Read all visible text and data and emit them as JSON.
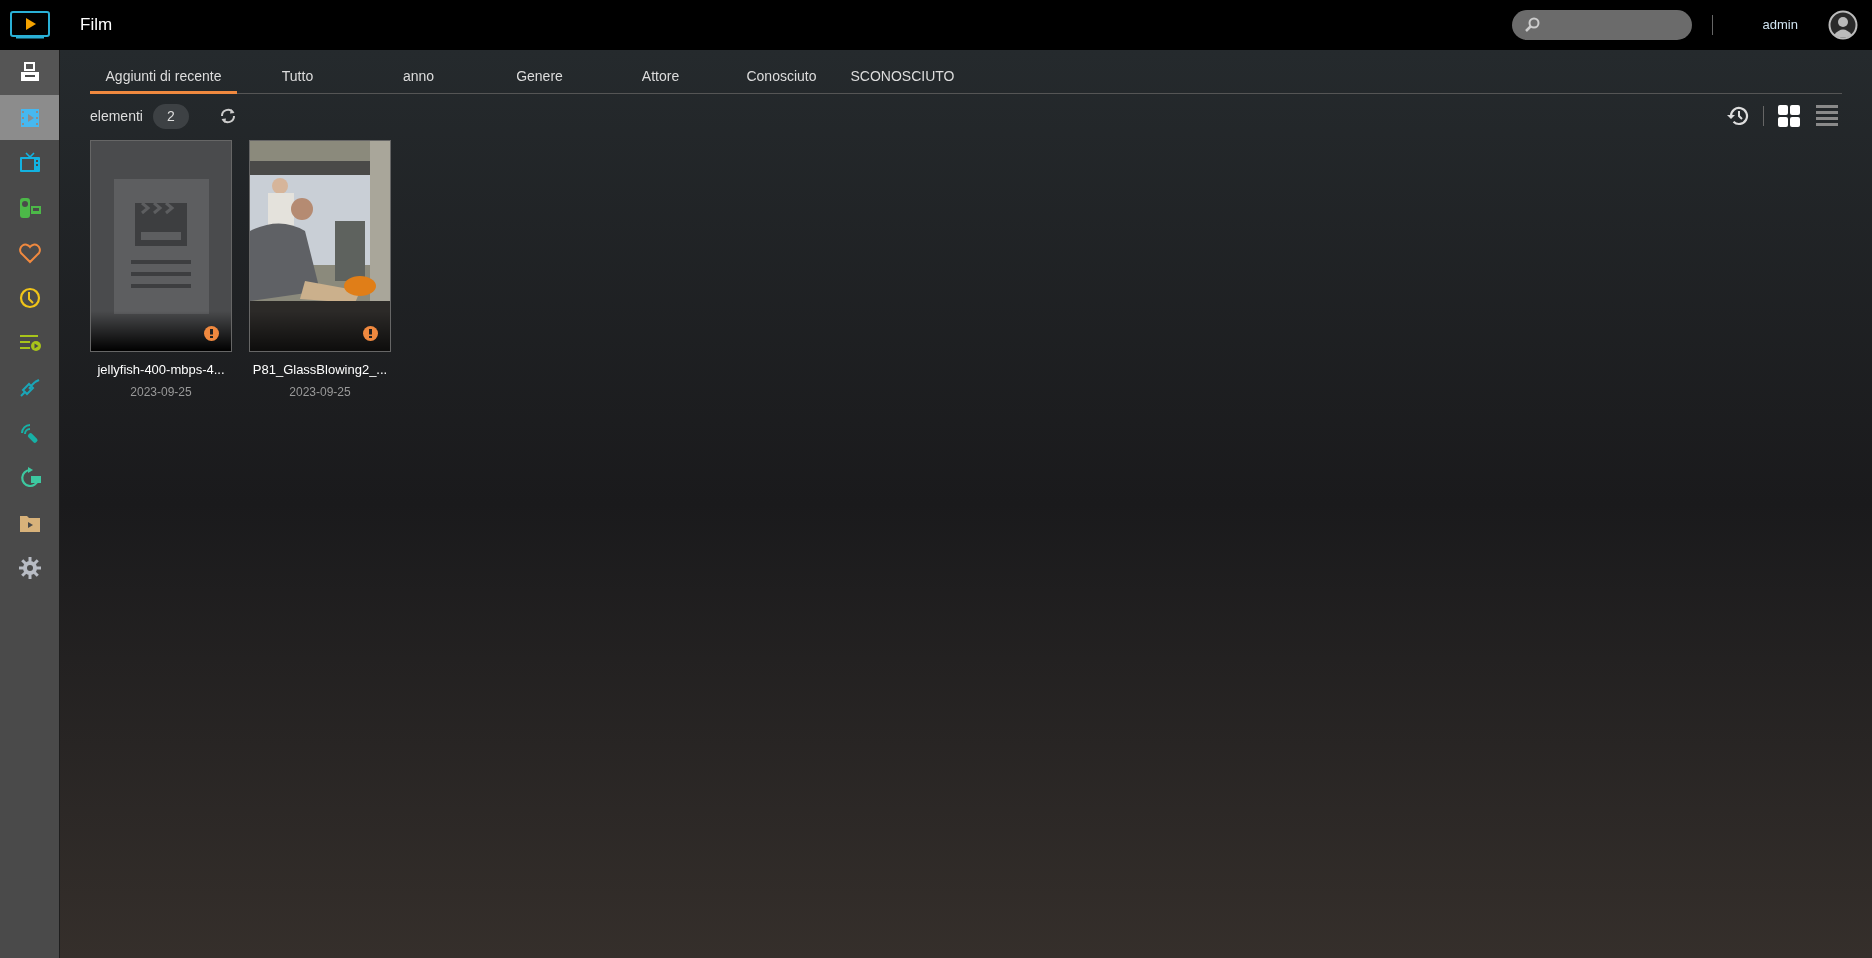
{
  "header": {
    "title": "Film",
    "user": "admin"
  },
  "sidebar": {
    "items": [
      {
        "kind": "server",
        "selected": false
      },
      {
        "kind": "film",
        "selected": true
      },
      {
        "kind": "tv",
        "selected": false
      },
      {
        "kind": "camera",
        "selected": false
      },
      {
        "kind": "heart",
        "selected": false
      },
      {
        "kind": "clock",
        "selected": false
      },
      {
        "kind": "playlist",
        "selected": false
      },
      {
        "kind": "link",
        "selected": false
      },
      {
        "kind": "remote",
        "selected": false
      },
      {
        "kind": "replay",
        "selected": false
      },
      {
        "kind": "folder",
        "selected": false
      },
      {
        "kind": "gear",
        "selected": false
      }
    ]
  },
  "tabs": [
    {
      "label": "Aggiunti di recente",
      "selected": true
    },
    {
      "label": "Tutto",
      "selected": false
    },
    {
      "label": "anno",
      "selected": false
    },
    {
      "label": "Genere",
      "selected": false
    },
    {
      "label": "Attore",
      "selected": false
    },
    {
      "label": "Conosciuto",
      "selected": false
    },
    {
      "label": "SCONOSCIUTO",
      "selected": false
    }
  ],
  "toolbar": {
    "items_label": "elementi",
    "count": "2",
    "views": [
      {
        "kind": "grid",
        "selected": true
      },
      {
        "kind": "list",
        "selected": false
      }
    ]
  },
  "cards": [
    {
      "kind": "placeholder",
      "title": "jellyfish-400-mbps-4...",
      "date": "2023-09-25",
      "warning": true
    },
    {
      "kind": "picture",
      "title": "P81_GlassBlowing2_...",
      "date": "2023-09-25",
      "warning": true
    }
  ]
}
